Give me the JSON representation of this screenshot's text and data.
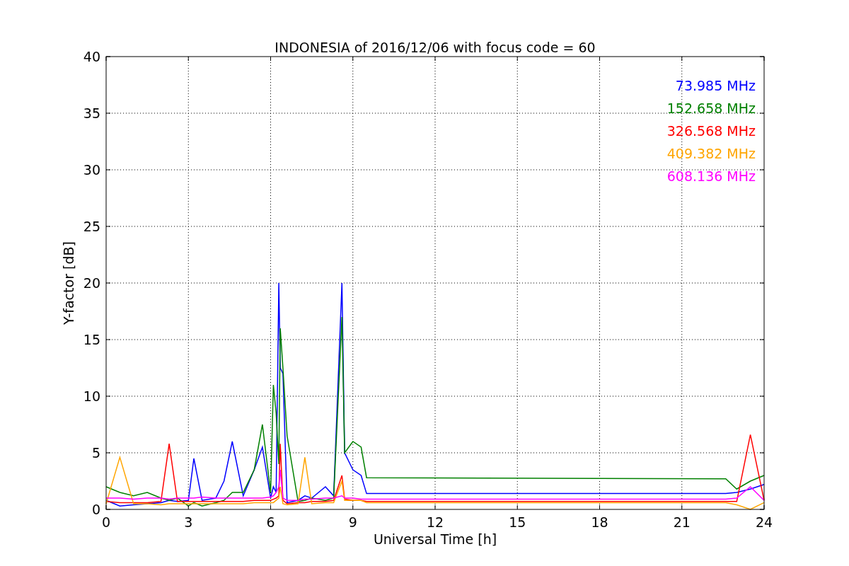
{
  "figure": {
    "chart_data": {
      "type": "line",
      "title": "INDONESIA of 2016/12/06 with focus code = 60",
      "xlabel": "Universal Time [h]",
      "ylabel": "Y-factor [dB]",
      "x": [
        0,
        0.5,
        1,
        1.5,
        2,
        2.3,
        2.6,
        3,
        3.2,
        3.5,
        4,
        4.3,
        4.6,
        5,
        5.4,
        5.7,
        6,
        6.1,
        6.2,
        6.3,
        6.35,
        6.45,
        6.6,
        7,
        7.25,
        7.5,
        8,
        8.3,
        8.6,
        8.7,
        9,
        9.3,
        9.5,
        22.6,
        23,
        23.5,
        24
      ],
      "series": [
        {
          "name": "73.985 MHz",
          "color": "#0000ff",
          "values": [
            0.8,
            0.3,
            0.4,
            0.5,
            0.6,
            0.8,
            0.7,
            0.8,
            4.5,
            0.8,
            1.0,
            2.5,
            6.0,
            1.2,
            3.5,
            5.5,
            1.0,
            2.0,
            1.5,
            20.0,
            12.5,
            12.0,
            0.6,
            0.8,
            1.2,
            1.0,
            2.0,
            1.2,
            20.0,
            5.0,
            3.5,
            3.0,
            1.4,
            1.4,
            1.5,
            1.8,
            2.2
          ]
        },
        {
          "name": "152.658 MHz",
          "color": "#008000",
          "values": [
            2.0,
            1.5,
            1.2,
            1.5,
            1.0,
            0.8,
            1.0,
            0.3,
            0.6,
            0.3,
            0.6,
            0.8,
            1.5,
            1.5,
            3.5,
            7.5,
            1.5,
            11.0,
            8.5,
            4.0,
            16.0,
            12.5,
            6.5,
            0.7,
            0.8,
            1.0,
            0.8,
            1.0,
            17.0,
            5.0,
            6.0,
            5.5,
            2.8,
            2.7,
            1.8,
            2.5,
            3.0
          ]
        },
        {
          "name": "326.568 MHz",
          "color": "#ff0000",
          "values": [
            0.7,
            0.6,
            0.6,
            0.6,
            0.7,
            5.8,
            0.7,
            0.7,
            0.7,
            0.7,
            0.7,
            0.7,
            0.7,
            0.7,
            0.8,
            0.8,
            0.8,
            0.9,
            1.0,
            1.2,
            5.8,
            0.8,
            0.5,
            0.6,
            0.6,
            0.7,
            0.7,
            0.8,
            3.0,
            0.9,
            0.8,
            0.8,
            0.7,
            0.7,
            0.7,
            6.6,
            0.8
          ]
        },
        {
          "name": "409.382 MHz",
          "color": "#ffa500",
          "values": [
            0.5,
            4.6,
            0.5,
            0.5,
            0.4,
            0.5,
            0.5,
            0.5,
            0.5,
            0.5,
            0.5,
            0.5,
            0.5,
            0.5,
            0.6,
            0.6,
            0.6,
            0.6,
            0.8,
            1.0,
            2.0,
            0.5,
            0.4,
            0.5,
            4.6,
            0.5,
            0.6,
            0.6,
            2.5,
            0.8,
            0.8,
            0.8,
            0.6,
            0.6,
            0.4,
            0.0,
            0.6
          ]
        },
        {
          "name": "608.136 MHz",
          "color": "#ff00ff",
          "values": [
            1.0,
            1.0,
            0.9,
            1.0,
            1.0,
            0.9,
            1.0,
            1.0,
            1.0,
            1.1,
            1.0,
            1.0,
            1.0,
            1.0,
            1.0,
            1.0,
            1.1,
            1.2,
            1.5,
            2.0,
            3.5,
            1.0,
            0.8,
            0.8,
            0.9,
            0.9,
            1.0,
            1.0,
            1.2,
            1.0,
            1.0,
            0.9,
            0.9,
            0.9,
            1.0,
            2.0,
            0.8
          ]
        }
      ],
      "xlim": [
        0,
        24
      ],
      "ylim": [
        0,
        40
      ],
      "grid": true,
      "xticks": [
        0,
        3,
        6,
        9,
        12,
        15,
        18,
        21,
        24
      ],
      "yticks": [
        0,
        5,
        10,
        15,
        20,
        25,
        30,
        35,
        40
      ]
    }
  }
}
